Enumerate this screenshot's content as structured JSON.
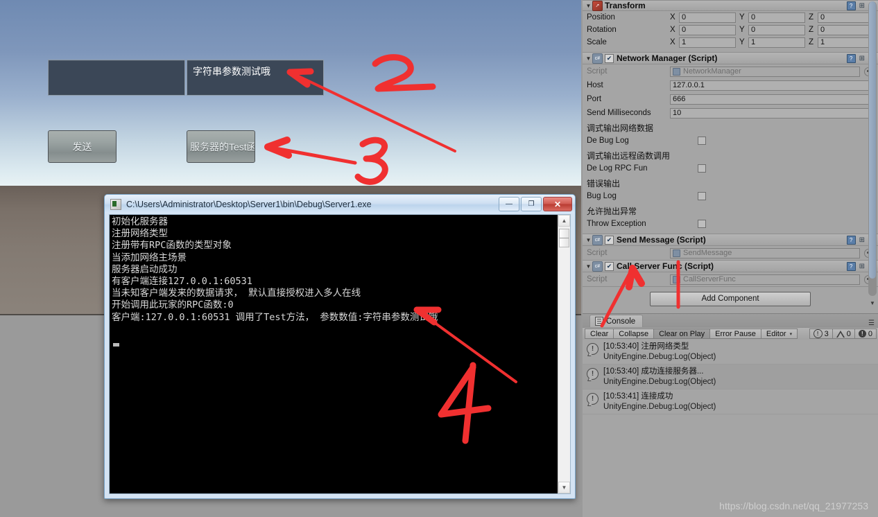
{
  "game_view": {
    "input_left": {
      "value": "",
      "placeholder": ""
    },
    "input_right": {
      "value": "字符串参数测试哦"
    },
    "button_send": "发送",
    "button_server_test": "服务器的Test函"
  },
  "cmd_window": {
    "title": "C:\\Users\\Administrator\\Desktop\\Server1\\bin\\Debug\\Server1.exe",
    "minimize": "—",
    "maximize": "❐",
    "close": "✕",
    "lines": [
      "初始化服务器",
      "注册网络类型",
      "注册带有RPC函数的类型对象",
      "当添加网络主场景",
      "服务器启动成功",
      "有客户端连接127.0.0.1:60531",
      "当未知客户端发来的数据请求， 默认直接授权进入多人在线",
      "开始调用此玩家的RPC函数:0",
      "客户端:127.0.0.1:60531 调用了Test方法， 参数数值:字符串参数测试哦"
    ]
  },
  "inspector": {
    "transform": {
      "title": "Transform",
      "rows": [
        {
          "label": "Position",
          "x": "0",
          "y": "0",
          "z": "0"
        },
        {
          "label": "Rotation",
          "x": "0",
          "y": "0",
          "z": "0"
        },
        {
          "label": "Scale",
          "x": "1",
          "y": "1",
          "z": "1"
        }
      ],
      "axis_x": "X",
      "axis_y": "Y",
      "axis_z": "Z"
    },
    "network_manager": {
      "title": "Network Manager (Script)",
      "script_label": "Script",
      "script_value": "NetworkManager",
      "fields": [
        {
          "label": "Host",
          "value": "127.0.0.1"
        },
        {
          "label": "Port",
          "value": "666"
        },
        {
          "label": "Send Milliseconds",
          "value": "10"
        }
      ],
      "checkboxes": [
        {
          "note": "调式输出网络数据",
          "label": "De Bug Log",
          "checked": false
        },
        {
          "note": "调式输出远程函数调用",
          "label": "De Log RPC Fun",
          "checked": false
        },
        {
          "note": "错误输出",
          "label": "Bug Log",
          "checked": false
        },
        {
          "note": "允许抛出异常",
          "label": "Throw Exception",
          "checked": false
        }
      ]
    },
    "send_message": {
      "title": "Send Message (Script)",
      "script_label": "Script",
      "script_value": "SendMessage"
    },
    "call_server_func": {
      "title": "Call Server Func (Script)",
      "script_label": "Script",
      "script_value": "CallServerFunc"
    },
    "add_component": "Add Component"
  },
  "console": {
    "tab_label": "Console",
    "buttons": [
      "Clear",
      "Collapse",
      "Clear on Play",
      "Error Pause"
    ],
    "editor_dropdown": "Editor",
    "counts": {
      "info": "3",
      "warning": "0",
      "error": "0"
    },
    "entries": [
      {
        "message": "[10:53:40] 注册网络类型",
        "stack": "UnityEngine.Debug:Log(Object)"
      },
      {
        "message": "[10:53:40] 成功连接服务器...",
        "stack": "UnityEngine.Debug:Log(Object)"
      },
      {
        "message": "[10:53:41] 连接成功",
        "stack": "UnityEngine.Debug:Log(Object)"
      }
    ]
  },
  "annotations": {
    "labels": [
      "2",
      "3",
      "4"
    ],
    "color": "#f03030"
  },
  "watermark": "https://blog.csdn.net/qq_21977253"
}
